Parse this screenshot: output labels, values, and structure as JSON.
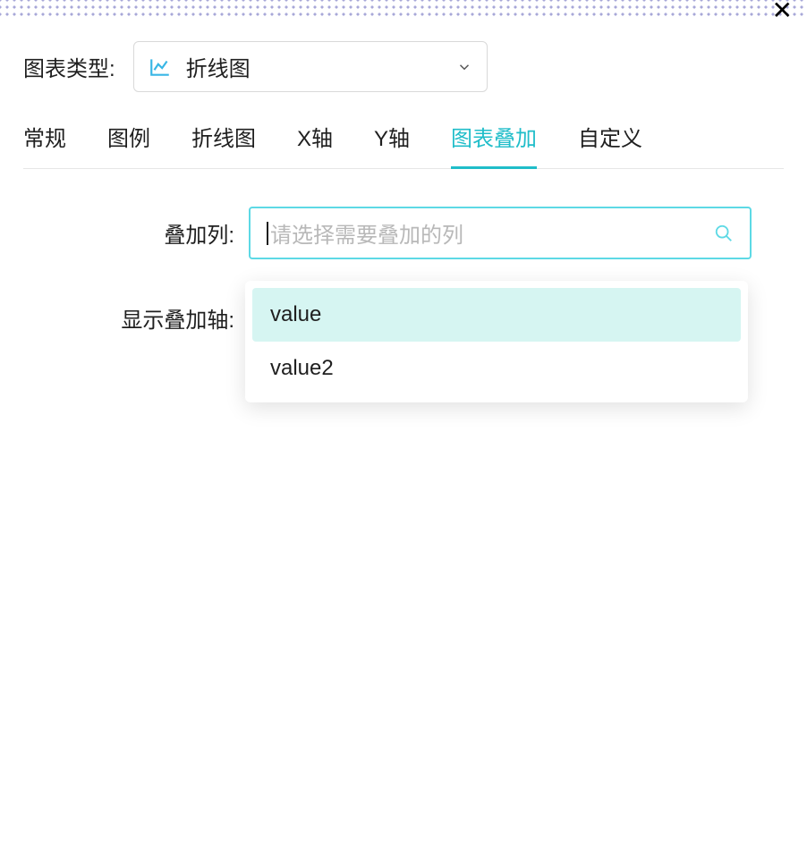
{
  "chart_type_label": "图表类型:",
  "chart_type_value": "折线图",
  "tabs": {
    "general": "常规",
    "legend": "图例",
    "line_chart": "折线图",
    "x_axis": "X轴",
    "y_axis": "Y轴",
    "chart_overlay": "图表叠加",
    "custom": "自定义"
  },
  "overlay_column_label": "叠加列:",
  "overlay_column_placeholder": "请选择需要叠加的列",
  "show_overlay_axis_label": "显示叠加轴:",
  "dropdown_options": {
    "value": "value",
    "value2": "value2"
  }
}
